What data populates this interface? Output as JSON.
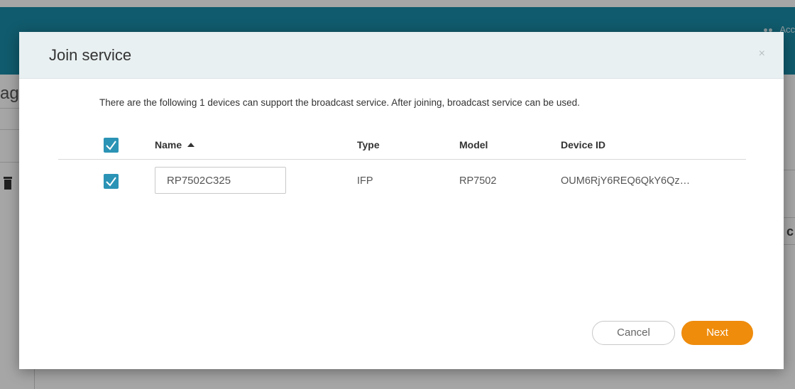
{
  "background": {
    "header_user_label": "Acc",
    "page_title_partial": "ag",
    "right_text_partial": "c"
  },
  "dialog": {
    "title": "Join service",
    "close_glyph": "×",
    "description": "There are the following 1 devices can support the broadcast service. After joining, broadcast service can be used.",
    "columns": {
      "name": "Name",
      "type": "Type",
      "model": "Model",
      "device_id": "Device ID"
    },
    "select_all_checked": true,
    "rows": [
      {
        "checked": true,
        "name": "RP7502C325",
        "type": "IFP",
        "model": "RP7502",
        "device_id": "OUM6RjY6REQ6QkY6Qz…"
      }
    ],
    "buttons": {
      "cancel": "Cancel",
      "next": "Next"
    }
  },
  "colors": {
    "header_bg": "#1a8ca8",
    "checkbox": "#2b93b5",
    "primary_button": "#ef8c0c",
    "dialog_header_bg": "#e9f0f1"
  },
  "icons": {
    "checkbox": "checkmark-icon",
    "sort": "sort-ascending-icon",
    "close": "close-icon",
    "delete": "trash-icon",
    "user": "user-group-icon"
  }
}
